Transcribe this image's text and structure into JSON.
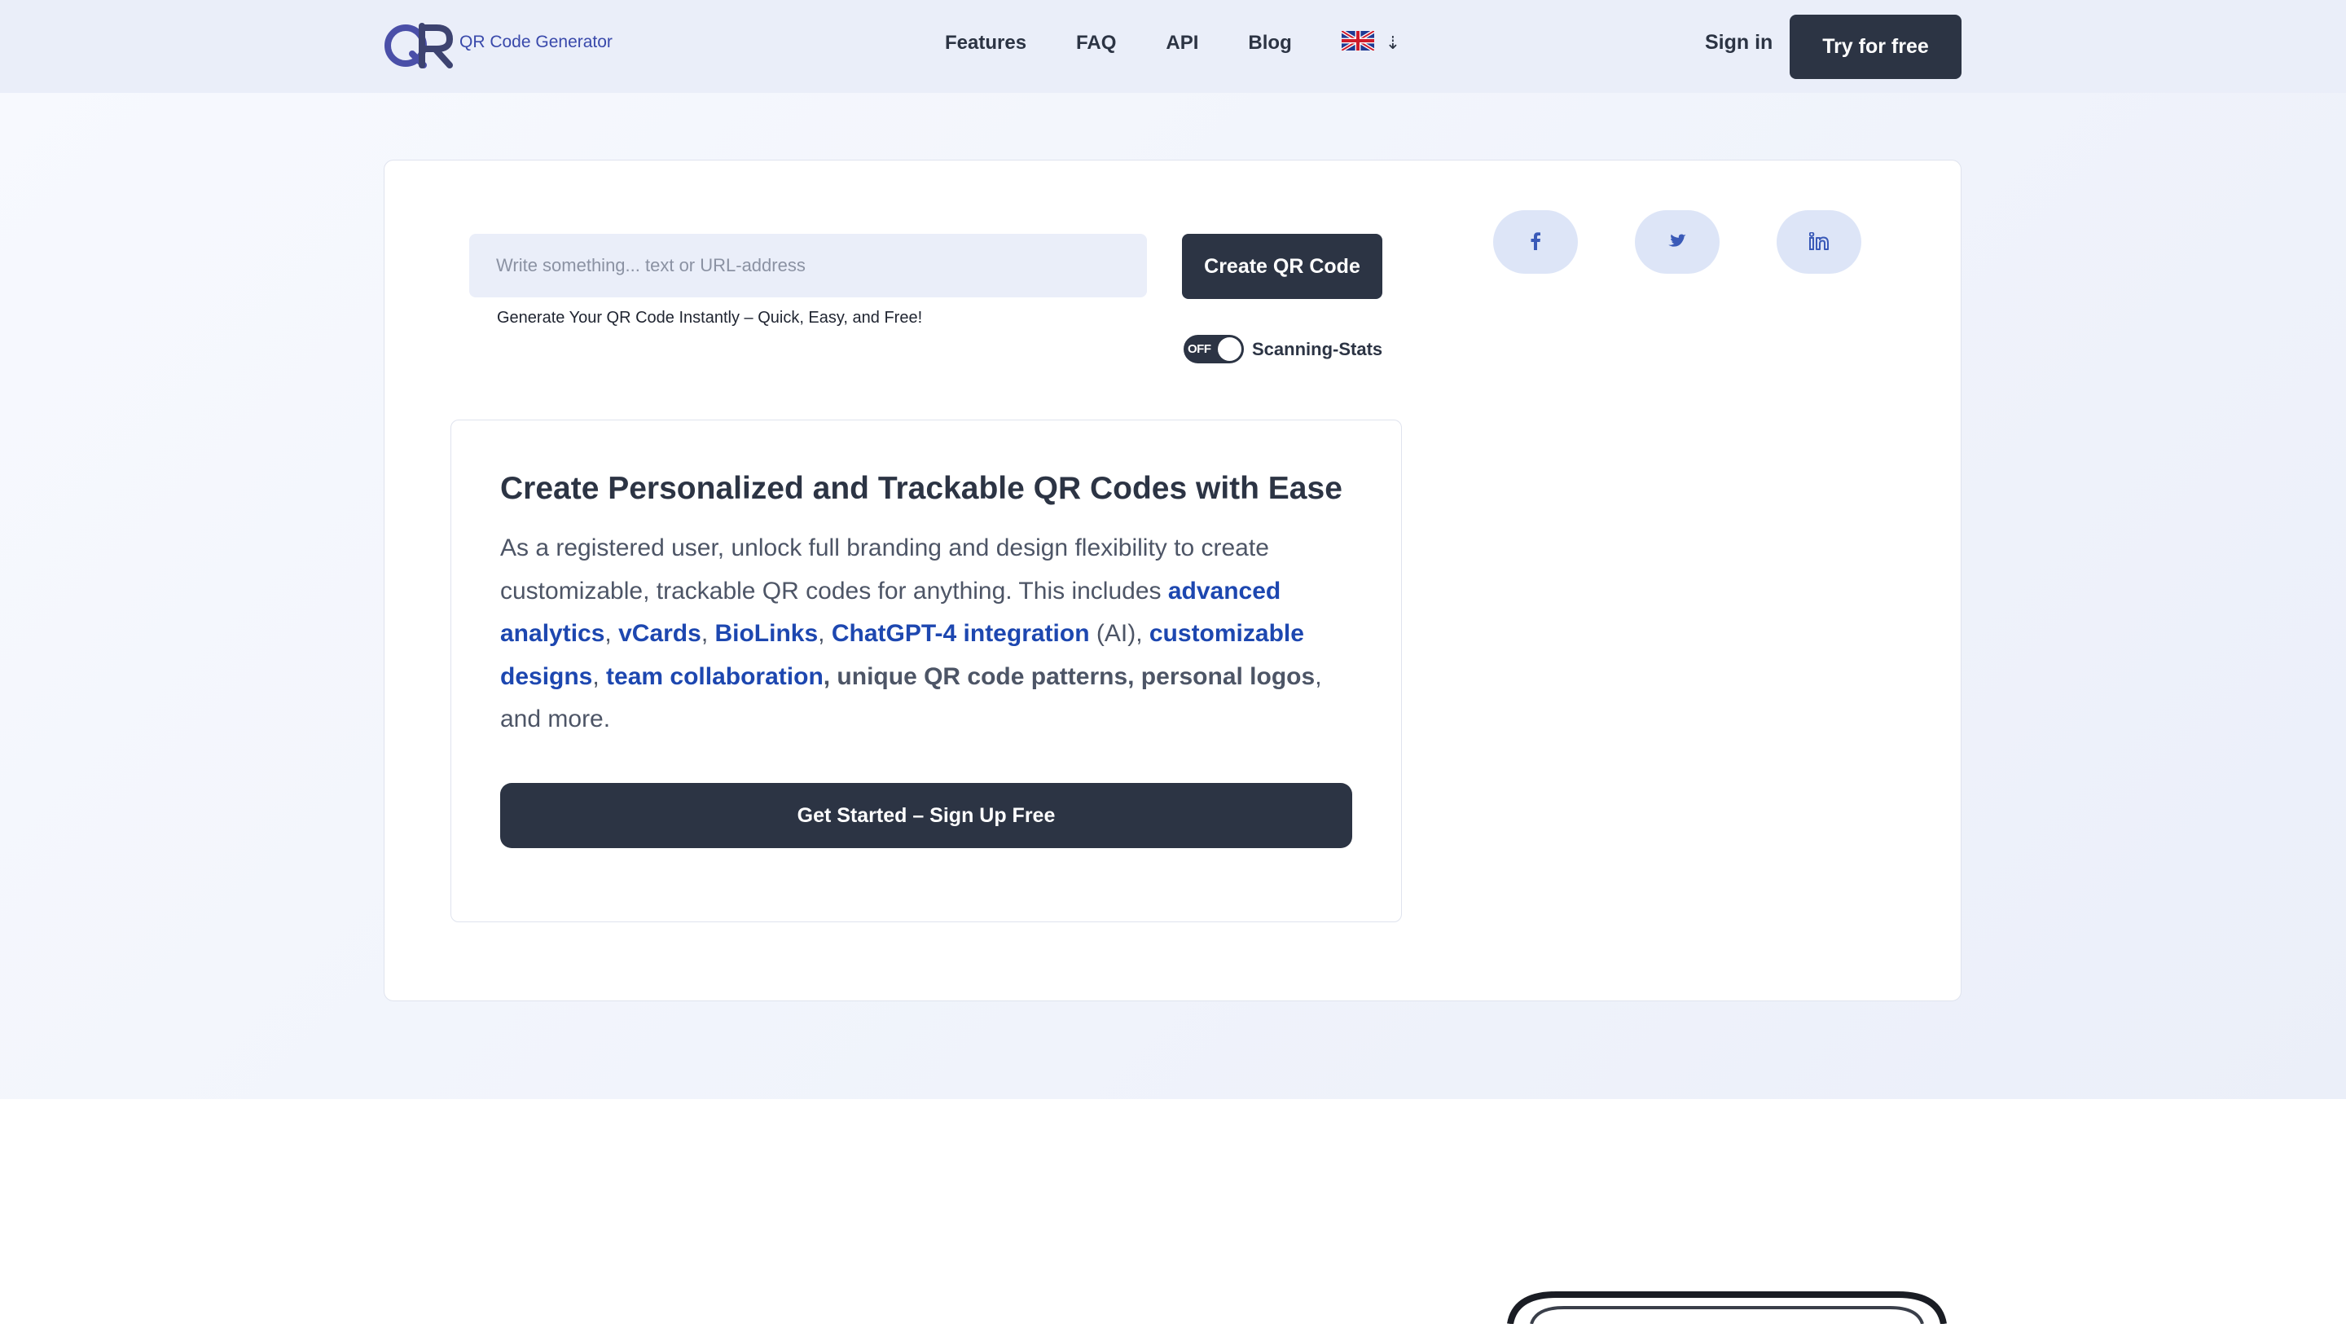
{
  "header": {
    "logo_text": "QR Code Generator",
    "nav": [
      "Features",
      "FAQ",
      "API",
      "Blog"
    ],
    "language_icon": "uk-flag-icon",
    "signin_label": "Sign in",
    "try_label": "Try for free"
  },
  "generator": {
    "input_placeholder": "Write something... text or URL-address",
    "input_value": "",
    "create_label": "Create QR Code",
    "helper_text": "Generate Your QR Code Instantly – Quick, Easy, and Free!",
    "toggle_state": "OFF",
    "toggle_label": "Scanning-Stats"
  },
  "social": {
    "facebook_icon": "facebook-icon",
    "twitter_icon": "twitter-icon",
    "linkedin_icon": "linkedin-icon"
  },
  "promo": {
    "title": "Create Personalized and Trackable QR Codes with Ease",
    "body_intro": "As a registered user, unlock full branding and design flexibility to create customizable, trackable QR codes for anything. This includes ",
    "link_advanced_analytics": "advanced analytics",
    "sep_1": ", ",
    "link_vcards": "vCards",
    "sep_2": ", ",
    "link_biolinks": "BioLinks",
    "sep_3": ", ",
    "link_chatgpt": "ChatGPT-4 integration",
    "text_ai": " (AI), ",
    "link_custom_designs": "customizable designs",
    "sep_4": ", ",
    "link_team": "team collaboration",
    "text_patterns": ", unique QR code patterns, personal logos",
    "text_end": ", and more.",
    "cta_label": "Get Started – Sign Up Free"
  },
  "colors": {
    "accent_dark": "#2c3444",
    "link_blue": "#1d47b0",
    "nav_bg": "#eaeef9",
    "logo_purple": "#4a4fa8"
  }
}
